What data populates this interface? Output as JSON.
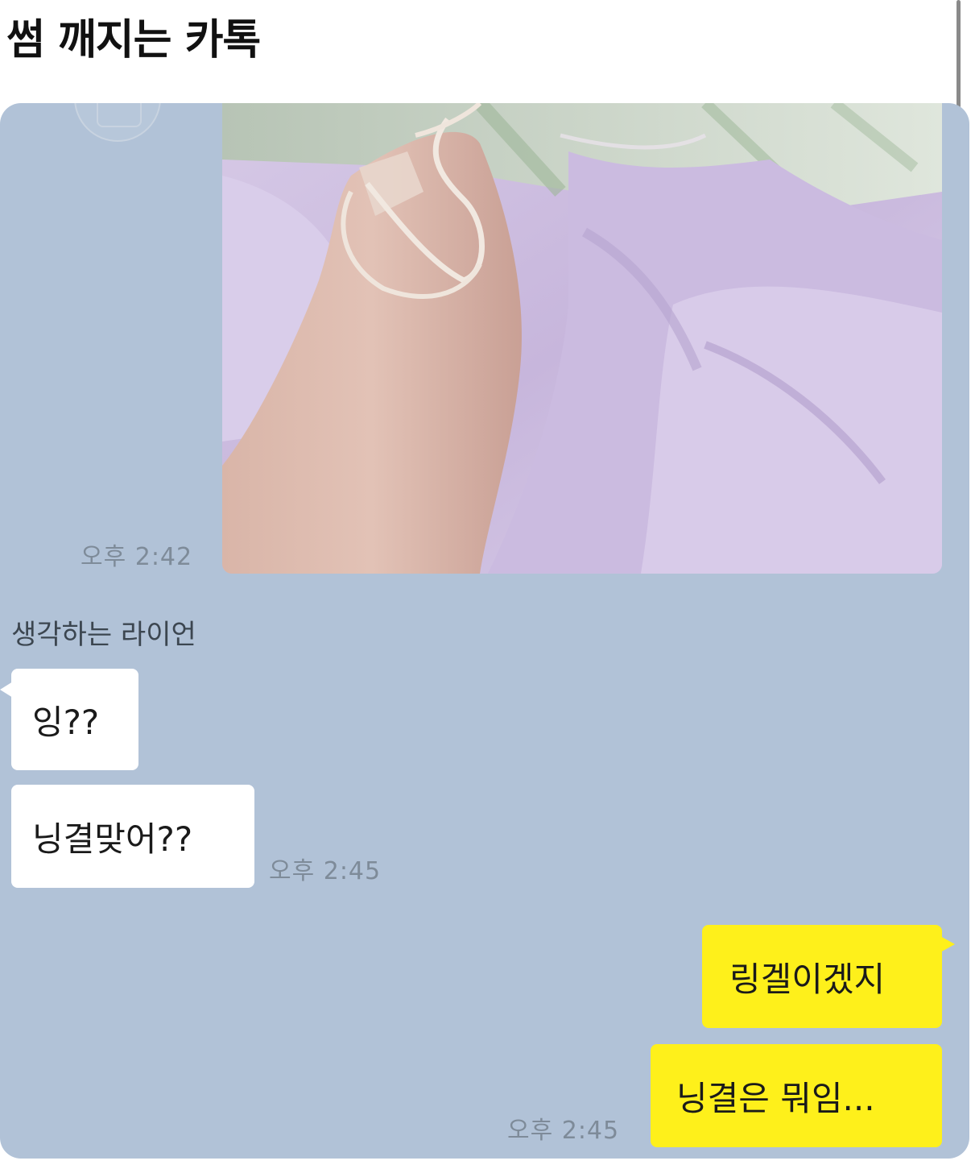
{
  "post": {
    "title": "썸 깨지는 카톡"
  },
  "chat": {
    "background_color": "#b1c2d7",
    "messages": [
      {
        "type": "image",
        "direction": "outgoing",
        "time": "오후 2:42"
      },
      {
        "sender": "생각하는 라이언",
        "direction": "incoming",
        "text": "잉??"
      },
      {
        "direction": "incoming",
        "text": "닝결맞어??",
        "time": "오후 2:45"
      },
      {
        "direction": "outgoing",
        "text": "링겔이겠지"
      },
      {
        "direction": "outgoing",
        "text": "닝결은 뭐임...",
        "time": "오후 2:45"
      }
    ],
    "colors": {
      "incoming_bubble": "#ffffff",
      "outgoing_bubble": "#fef01b",
      "timestamp": "#7e8b99"
    }
  }
}
